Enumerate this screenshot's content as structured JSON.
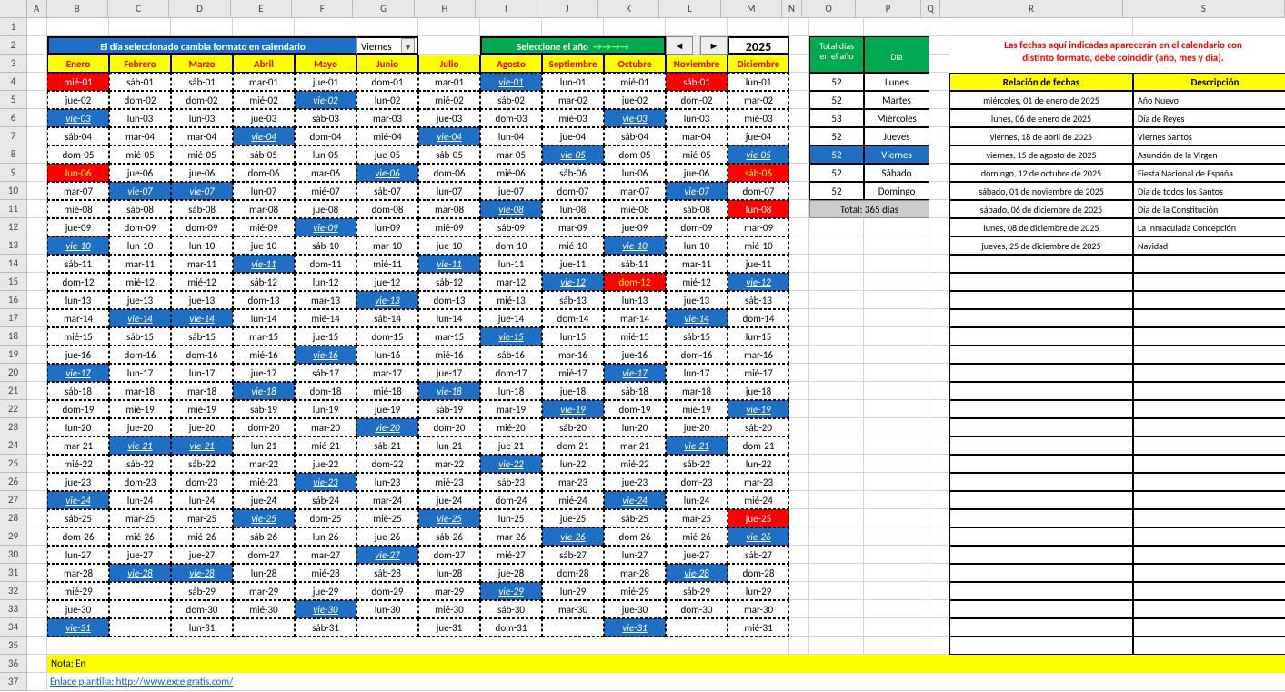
{
  "colwidths": {
    "rownum": 30,
    "A": 22,
    "B": 68,
    "C": 68,
    "D": 68,
    "E": 68,
    "F": 68,
    "G": 68,
    "H": 68,
    "I": 68,
    "J": 68,
    "K": 68,
    "L": 68,
    "M": 68,
    "N": 22,
    "O": 60,
    "P": 72,
    "Q": 22,
    "R": 202,
    "S": 180
  },
  "cols": [
    "A",
    "B",
    "C",
    "D",
    "E",
    "F",
    "G",
    "H",
    "I",
    "J",
    "K",
    "L",
    "M",
    "N",
    "O",
    "P",
    "Q",
    "R",
    "S"
  ],
  "title": "El día seleccionado cambia formato en calendario",
  "dropdown": "Viernes",
  "yearSelect": "Seleccione el año",
  "year": "2025",
  "totHdr1": "Total días",
  "totHdr2": "en el año",
  "diaHdr": "Día",
  "note1a": "Las  fechas aquí indicadas aparecerán en el calendario con",
  "note1b": "distinto formato, debe coincidir (año, mes y dia).",
  "months": [
    "Enero",
    "Febrero",
    "Marzo",
    "Abril",
    "Mayo",
    "Junio",
    "Julio",
    "Agosto",
    "Septiembre",
    "Octubre",
    "Noviembre",
    "Diciembre"
  ],
  "calendar": [
    [
      [
        "mié-01",
        "hol"
      ],
      [
        "sáb-01",
        ""
      ],
      [
        "sáb-01",
        ""
      ],
      [
        "mar-01",
        ""
      ],
      [
        "jue-01",
        ""
      ],
      [
        "dom-01",
        ""
      ],
      [
        "mar-01",
        ""
      ],
      [
        "vie-01",
        "hl"
      ],
      [
        "lun-01",
        ""
      ],
      [
        "mié-01",
        ""
      ],
      [
        "sáb-01",
        "hol"
      ],
      [
        "lun-01",
        ""
      ]
    ],
    [
      [
        "jue-02",
        ""
      ],
      [
        "dom-02",
        ""
      ],
      [
        "dom-02",
        ""
      ],
      [
        "mié-02",
        ""
      ],
      [
        "vie-02",
        "hl"
      ],
      [
        "lun-02",
        ""
      ],
      [
        "mié-02",
        ""
      ],
      [
        "sáb-02",
        ""
      ],
      [
        "mar-02",
        ""
      ],
      [
        "jue-02",
        ""
      ],
      [
        "dom-02",
        ""
      ],
      [
        "mar-02",
        ""
      ]
    ],
    [
      [
        "vie-03",
        "hl"
      ],
      [
        "lun-03",
        ""
      ],
      [
        "lun-03",
        ""
      ],
      [
        "jue-03",
        ""
      ],
      [
        "sáb-03",
        ""
      ],
      [
        "mar-03",
        ""
      ],
      [
        "jue-03",
        ""
      ],
      [
        "dom-03",
        ""
      ],
      [
        "mié-03",
        ""
      ],
      [
        "vie-03",
        "hl"
      ],
      [
        "lun-03",
        ""
      ],
      [
        "mié-03",
        ""
      ]
    ],
    [
      [
        "sáb-04",
        ""
      ],
      [
        "mar-04",
        ""
      ],
      [
        "mar-04",
        ""
      ],
      [
        "vie-04",
        "hl"
      ],
      [
        "dom-04",
        ""
      ],
      [
        "mié-04",
        ""
      ],
      [
        "vie-04",
        "hl"
      ],
      [
        "lun-04",
        ""
      ],
      [
        "jue-04",
        ""
      ],
      [
        "sáb-04",
        ""
      ],
      [
        "mar-04",
        ""
      ],
      [
        "jue-04",
        ""
      ]
    ],
    [
      [
        "dom-05",
        ""
      ],
      [
        "mié-05",
        ""
      ],
      [
        "mié-05",
        ""
      ],
      [
        "sáb-05",
        ""
      ],
      [
        "lun-05",
        ""
      ],
      [
        "jue-05",
        ""
      ],
      [
        "sáb-05",
        ""
      ],
      [
        "mar-05",
        ""
      ],
      [
        "vie-05",
        "hl"
      ],
      [
        "dom-05",
        ""
      ],
      [
        "mié-05",
        ""
      ],
      [
        "vie-05",
        "hl"
      ]
    ],
    [
      [
        "lun-06",
        "hol2"
      ],
      [
        "jue-06",
        ""
      ],
      [
        "jue-06",
        ""
      ],
      [
        "dom-06",
        ""
      ],
      [
        "mar-06",
        ""
      ],
      [
        "vie-06",
        "hl"
      ],
      [
        "dom-06",
        ""
      ],
      [
        "mié-06",
        ""
      ],
      [
        "sáb-06",
        ""
      ],
      [
        "lun-06",
        ""
      ],
      [
        "jue-06",
        ""
      ],
      [
        "sáb-06",
        "hol2"
      ]
    ],
    [
      [
        "mar-07",
        ""
      ],
      [
        "vie-07",
        "hl"
      ],
      [
        "vie-07",
        "hl"
      ],
      [
        "lun-07",
        ""
      ],
      [
        "mié-07",
        ""
      ],
      [
        "sáb-07",
        ""
      ],
      [
        "lun-07",
        ""
      ],
      [
        "jue-07",
        ""
      ],
      [
        "dom-07",
        ""
      ],
      [
        "mar-07",
        ""
      ],
      [
        "vie-07",
        "hl"
      ],
      [
        "dom-07",
        ""
      ]
    ],
    [
      [
        "mié-08",
        ""
      ],
      [
        "sáb-08",
        ""
      ],
      [
        "sáb-08",
        ""
      ],
      [
        "mar-08",
        ""
      ],
      [
        "jue-08",
        ""
      ],
      [
        "dom-08",
        ""
      ],
      [
        "mar-08",
        ""
      ],
      [
        "vie-08",
        "hl"
      ],
      [
        "lun-08",
        ""
      ],
      [
        "mié-08",
        ""
      ],
      [
        "sáb-08",
        ""
      ],
      [
        "lun-08",
        "hol"
      ]
    ],
    [
      [
        "jue-09",
        ""
      ],
      [
        "dom-09",
        ""
      ],
      [
        "dom-09",
        ""
      ],
      [
        "mié-09",
        ""
      ],
      [
        "vie-09",
        "hl"
      ],
      [
        "lun-09",
        ""
      ],
      [
        "mié-09",
        ""
      ],
      [
        "sáb-09",
        ""
      ],
      [
        "mar-09",
        ""
      ],
      [
        "jue-09",
        ""
      ],
      [
        "dom-09",
        ""
      ],
      [
        "mar-09",
        ""
      ]
    ],
    [
      [
        "vie-10",
        "hl"
      ],
      [
        "lun-10",
        ""
      ],
      [
        "lun-10",
        ""
      ],
      [
        "jue-10",
        ""
      ],
      [
        "sáb-10",
        ""
      ],
      [
        "mar-10",
        ""
      ],
      [
        "jue-10",
        ""
      ],
      [
        "dom-10",
        ""
      ],
      [
        "mié-10",
        ""
      ],
      [
        "vie-10",
        "hl"
      ],
      [
        "lun-10",
        ""
      ],
      [
        "mié-10",
        ""
      ]
    ],
    [
      [
        "sáb-11",
        ""
      ],
      [
        "mar-11",
        ""
      ],
      [
        "mar-11",
        ""
      ],
      [
        "vie-11",
        "hl"
      ],
      [
        "dom-11",
        ""
      ],
      [
        "mié-11",
        ""
      ],
      [
        "vie-11",
        "hl"
      ],
      [
        "lun-11",
        ""
      ],
      [
        "jue-11",
        ""
      ],
      [
        "sáb-11",
        ""
      ],
      [
        "mar-11",
        ""
      ],
      [
        "jue-11",
        ""
      ]
    ],
    [
      [
        "dom-12",
        ""
      ],
      [
        "mié-12",
        ""
      ],
      [
        "mié-12",
        ""
      ],
      [
        "sáb-12",
        ""
      ],
      [
        "lun-12",
        ""
      ],
      [
        "jue-12",
        ""
      ],
      [
        "sáb-12",
        ""
      ],
      [
        "mar-12",
        ""
      ],
      [
        "vie-12",
        "hl"
      ],
      [
        "dom-12",
        "hol2"
      ],
      [
        "mié-12",
        ""
      ],
      [
        "vie-12",
        "hl"
      ]
    ],
    [
      [
        "lun-13",
        ""
      ],
      [
        "jue-13",
        ""
      ],
      [
        "jue-13",
        ""
      ],
      [
        "dom-13",
        ""
      ],
      [
        "mar-13",
        ""
      ],
      [
        "vie-13",
        "hl"
      ],
      [
        "dom-13",
        ""
      ],
      [
        "mié-13",
        ""
      ],
      [
        "sáb-13",
        ""
      ],
      [
        "lun-13",
        ""
      ],
      [
        "jue-13",
        ""
      ],
      [
        "sáb-13",
        ""
      ]
    ],
    [
      [
        "mar-14",
        ""
      ],
      [
        "vie-14",
        "hl"
      ],
      [
        "vie-14",
        "hl"
      ],
      [
        "lun-14",
        ""
      ],
      [
        "mié-14",
        ""
      ],
      [
        "sáb-14",
        ""
      ],
      [
        "lun-14",
        ""
      ],
      [
        "jue-14",
        ""
      ],
      [
        "dom-14",
        ""
      ],
      [
        "mar-14",
        ""
      ],
      [
        "vie-14",
        "hl"
      ],
      [
        "dom-14",
        ""
      ]
    ],
    [
      [
        "mié-15",
        ""
      ],
      [
        "sáb-15",
        ""
      ],
      [
        "sáb-15",
        ""
      ],
      [
        "mar-15",
        ""
      ],
      [
        "jue-15",
        ""
      ],
      [
        "dom-15",
        ""
      ],
      [
        "mar-15",
        ""
      ],
      [
        "vie-15",
        "hl"
      ],
      [
        "lun-15",
        ""
      ],
      [
        "mié-15",
        ""
      ],
      [
        "sáb-15",
        ""
      ],
      [
        "lun-15",
        ""
      ]
    ],
    [
      [
        "jue-16",
        ""
      ],
      [
        "dom-16",
        ""
      ],
      [
        "dom-16",
        ""
      ],
      [
        "mié-16",
        ""
      ],
      [
        "vie-16",
        "hl"
      ],
      [
        "lun-16",
        ""
      ],
      [
        "mié-16",
        ""
      ],
      [
        "sáb-16",
        ""
      ],
      [
        "mar-16",
        ""
      ],
      [
        "jue-16",
        ""
      ],
      [
        "dom-16",
        ""
      ],
      [
        "mar-16",
        ""
      ]
    ],
    [
      [
        "vie-17",
        "hl"
      ],
      [
        "lun-17",
        ""
      ],
      [
        "lun-17",
        ""
      ],
      [
        "jue-17",
        ""
      ],
      [
        "sáb-17",
        ""
      ],
      [
        "mar-17",
        ""
      ],
      [
        "jue-17",
        ""
      ],
      [
        "dom-17",
        ""
      ],
      [
        "mié-17",
        ""
      ],
      [
        "vie-17",
        "hl"
      ],
      [
        "lun-17",
        ""
      ],
      [
        "mié-17",
        ""
      ]
    ],
    [
      [
        "sáb-18",
        ""
      ],
      [
        "mar-18",
        ""
      ],
      [
        "mar-18",
        ""
      ],
      [
        "vie-18",
        "hl"
      ],
      [
        "dom-18",
        ""
      ],
      [
        "mié-18",
        ""
      ],
      [
        "vie-18",
        "hl"
      ],
      [
        "lun-18",
        ""
      ],
      [
        "jue-18",
        ""
      ],
      [
        "sáb-18",
        ""
      ],
      [
        "mar-18",
        ""
      ],
      [
        "jue-18",
        ""
      ]
    ],
    [
      [
        "dom-19",
        ""
      ],
      [
        "mié-19",
        ""
      ],
      [
        "mié-19",
        ""
      ],
      [
        "sáb-19",
        ""
      ],
      [
        "lun-19",
        ""
      ],
      [
        "jue-19",
        ""
      ],
      [
        "sáb-19",
        ""
      ],
      [
        "mar-19",
        ""
      ],
      [
        "vie-19",
        "hl"
      ],
      [
        "dom-19",
        ""
      ],
      [
        "mié-19",
        ""
      ],
      [
        "vie-19",
        "hl"
      ]
    ],
    [
      [
        "lun-20",
        ""
      ],
      [
        "jue-20",
        ""
      ],
      [
        "jue-20",
        ""
      ],
      [
        "dom-20",
        ""
      ],
      [
        "mar-20",
        ""
      ],
      [
        "vie-20",
        "hl"
      ],
      [
        "dom-20",
        ""
      ],
      [
        "mié-20",
        ""
      ],
      [
        "sáb-20",
        ""
      ],
      [
        "lun-20",
        ""
      ],
      [
        "jue-20",
        ""
      ],
      [
        "sáb-20",
        ""
      ]
    ],
    [
      [
        "mar-21",
        ""
      ],
      [
        "vie-21",
        "hl"
      ],
      [
        "vie-21",
        "hl"
      ],
      [
        "lun-21",
        ""
      ],
      [
        "mié-21",
        ""
      ],
      [
        "sáb-21",
        ""
      ],
      [
        "lun-21",
        ""
      ],
      [
        "jue-21",
        ""
      ],
      [
        "dom-21",
        ""
      ],
      [
        "mar-21",
        ""
      ],
      [
        "vie-21",
        "hl"
      ],
      [
        "dom-21",
        ""
      ]
    ],
    [
      [
        "mié-22",
        ""
      ],
      [
        "sáb-22",
        ""
      ],
      [
        "sáb-22",
        ""
      ],
      [
        "mar-22",
        ""
      ],
      [
        "jue-22",
        ""
      ],
      [
        "dom-22",
        ""
      ],
      [
        "mar-22",
        ""
      ],
      [
        "vie-22",
        "hl"
      ],
      [
        "lun-22",
        ""
      ],
      [
        "mié-22",
        ""
      ],
      [
        "sáb-22",
        ""
      ],
      [
        "lun-22",
        ""
      ]
    ],
    [
      [
        "jue-23",
        ""
      ],
      [
        "dom-23",
        ""
      ],
      [
        "dom-23",
        ""
      ],
      [
        "mié-23",
        ""
      ],
      [
        "vie-23",
        "hl"
      ],
      [
        "lun-23",
        ""
      ],
      [
        "mié-23",
        ""
      ],
      [
        "sáb-23",
        ""
      ],
      [
        "mar-23",
        ""
      ],
      [
        "jue-23",
        ""
      ],
      [
        "dom-23",
        ""
      ],
      [
        "mar-23",
        ""
      ]
    ],
    [
      [
        "vie-24",
        "hl"
      ],
      [
        "lun-24",
        ""
      ],
      [
        "lun-24",
        ""
      ],
      [
        "jue-24",
        ""
      ],
      [
        "sáb-24",
        ""
      ],
      [
        "mar-24",
        ""
      ],
      [
        "jue-24",
        ""
      ],
      [
        "dom-24",
        ""
      ],
      [
        "mié-24",
        ""
      ],
      [
        "vie-24",
        "hl"
      ],
      [
        "lun-24",
        ""
      ],
      [
        "mié-24",
        ""
      ]
    ],
    [
      [
        "sáb-25",
        ""
      ],
      [
        "mar-25",
        ""
      ],
      [
        "mar-25",
        ""
      ],
      [
        "vie-25",
        "hl"
      ],
      [
        "dom-25",
        ""
      ],
      [
        "mié-25",
        ""
      ],
      [
        "vie-25",
        "hl"
      ],
      [
        "lun-25",
        ""
      ],
      [
        "jue-25",
        ""
      ],
      [
        "sáb-25",
        ""
      ],
      [
        "mar-25",
        ""
      ],
      [
        "jue-25",
        "hol"
      ]
    ],
    [
      [
        "dom-26",
        ""
      ],
      [
        "mié-26",
        ""
      ],
      [
        "mié-26",
        ""
      ],
      [
        "sáb-26",
        ""
      ],
      [
        "lun-26",
        ""
      ],
      [
        "jue-26",
        ""
      ],
      [
        "sáb-26",
        ""
      ],
      [
        "mar-26",
        ""
      ],
      [
        "vie-26",
        "hl"
      ],
      [
        "dom-26",
        ""
      ],
      [
        "mié-26",
        ""
      ],
      [
        "vie-26",
        "hl"
      ]
    ],
    [
      [
        "lun-27",
        ""
      ],
      [
        "jue-27",
        ""
      ],
      [
        "jue-27",
        ""
      ],
      [
        "dom-27",
        ""
      ],
      [
        "mar-27",
        ""
      ],
      [
        "vie-27",
        "hl"
      ],
      [
        "dom-27",
        ""
      ],
      [
        "mié-27",
        ""
      ],
      [
        "sáb-27",
        ""
      ],
      [
        "lun-27",
        ""
      ],
      [
        "jue-27",
        ""
      ],
      [
        "sáb-27",
        ""
      ]
    ],
    [
      [
        "mar-28",
        ""
      ],
      [
        "vie-28",
        "hl"
      ],
      [
        "vie-28",
        "hl"
      ],
      [
        "lun-28",
        ""
      ],
      [
        "mié-28",
        ""
      ],
      [
        "sáb-28",
        ""
      ],
      [
        "lun-28",
        ""
      ],
      [
        "jue-28",
        ""
      ],
      [
        "dom-28",
        ""
      ],
      [
        "mar-28",
        ""
      ],
      [
        "vie-28",
        "hl"
      ],
      [
        "dom-28",
        ""
      ]
    ],
    [
      [
        "mié-29",
        ""
      ],
      [
        "",
        ""
      ],
      [
        "sáb-29",
        ""
      ],
      [
        "mar-29",
        ""
      ],
      [
        "jue-29",
        ""
      ],
      [
        "dom-29",
        ""
      ],
      [
        "mar-29",
        ""
      ],
      [
        "vie-29",
        "hl"
      ],
      [
        "lun-29",
        ""
      ],
      [
        "mié-29",
        ""
      ],
      [
        "sáb-29",
        ""
      ],
      [
        "lun-29",
        ""
      ]
    ],
    [
      [
        "jue-30",
        ""
      ],
      [
        "",
        ""
      ],
      [
        "dom-30",
        ""
      ],
      [
        "mié-30",
        ""
      ],
      [
        "vie-30",
        "hl"
      ],
      [
        "lun-30",
        ""
      ],
      [
        "mié-30",
        ""
      ],
      [
        "sáb-30",
        ""
      ],
      [
        "mar-30",
        ""
      ],
      [
        "jue-30",
        ""
      ],
      [
        "dom-30",
        ""
      ],
      [
        "mar-30",
        ""
      ]
    ],
    [
      [
        "vie-31",
        "hl"
      ],
      [
        "",
        ""
      ],
      [
        "lun-31",
        ""
      ],
      [
        "",
        ""
      ],
      [
        "sáb-31",
        ""
      ],
      [
        "",
        ""
      ],
      [
        "jue-31",
        ""
      ],
      [
        "dom-31",
        ""
      ],
      [
        "",
        ""
      ],
      [
        "vie-31",
        "hl"
      ],
      [
        "",
        ""
      ],
      [
        "mié-31",
        ""
      ]
    ]
  ],
  "stats": [
    [
      "52",
      "Lunes",
      ""
    ],
    [
      "52",
      "Martes",
      ""
    ],
    [
      "53",
      "Miércoles",
      ""
    ],
    [
      "52",
      "Jueves",
      ""
    ],
    [
      "52",
      "Viernes",
      "hl"
    ],
    [
      "52",
      "Sábado",
      ""
    ],
    [
      "52",
      "Domingo",
      ""
    ]
  ],
  "total365": "Total: 365 días",
  "relHdr1": "Relación de fechas",
  "relHdr2": "Descripción",
  "rel": [
    [
      "miércoles, 01 de enero de 2025",
      "Año Nuevo"
    ],
    [
      "lunes, 06 de enero de 2025",
      "Día de Reyes"
    ],
    [
      "viernes, 18 de abril de 2025",
      "Viernes Santos"
    ],
    [
      "viernes, 15 de agosto de 2025",
      "Asunción de la Virgen"
    ],
    [
      "domingo, 12 de octubre de 2025",
      "Fiesta Nacional de España"
    ],
    [
      "sábado, 01 de noviembre de 2025",
      "Día de todos los Santos"
    ],
    [
      "sábado, 06 de diciembre de 2025",
      "Día de la Constitución"
    ],
    [
      "lunes, 08 de diciembre de 2025",
      "La Inmaculada Concepción"
    ],
    [
      "jueves, 25 de diciembre de 2025",
      "Navidad"
    ]
  ],
  "noteLabel": "Nota:  En",
  "linkLabel": "Enlace plantilla:  http://www.excelgratis.com/"
}
